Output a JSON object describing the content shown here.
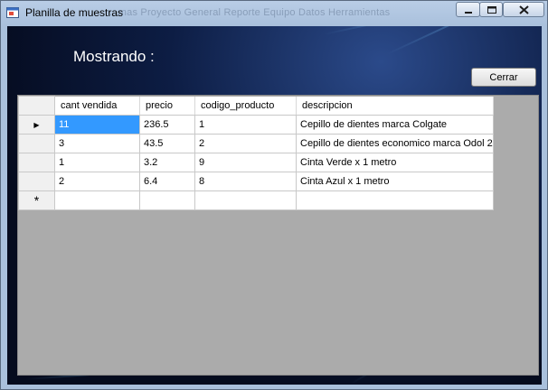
{
  "window": {
    "title": "Planilla de muestras",
    "background_menu": "...mas   Proyecto   General   Reporte   Equipo   Datos   Herramientas"
  },
  "form": {
    "label": "Mostrando :",
    "close_button": "Cerrar"
  },
  "grid": {
    "columns": [
      "cant vendida",
      "precio",
      "codigo_producto",
      "descripcion"
    ],
    "rows": [
      [
        "11",
        "236.5",
        "1",
        "Cepillo de dientes marca Colgate"
      ],
      [
        "3",
        "43.5",
        "2",
        "Cepillo de dientes economico marca Odol 2"
      ],
      [
        "1",
        "3.2",
        "9",
        "Cinta Verde x 1 metro"
      ],
      [
        "2",
        "6.4",
        "8",
        "Cinta Azul x 1 metro"
      ]
    ],
    "current_row_indicator": "▶",
    "new_row_indicator": "*",
    "selection_color": "#3399ff"
  }
}
